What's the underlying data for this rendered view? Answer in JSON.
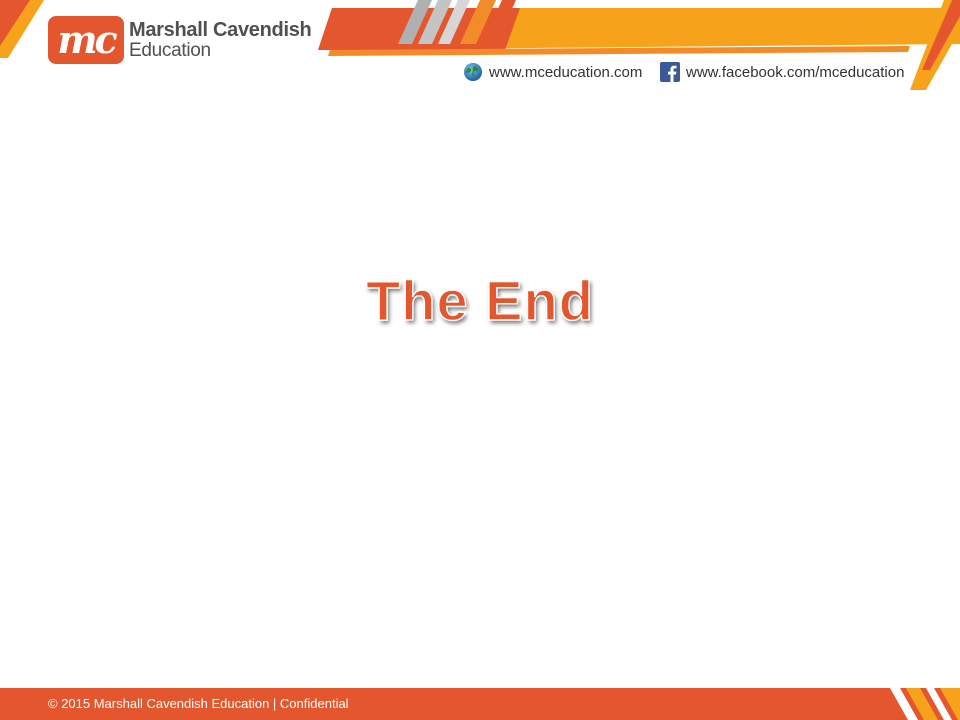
{
  "brand": {
    "logo_mark": "mc",
    "name": "Marshall Cavendish",
    "subtitle": "Education",
    "primary_color": "#e4572e",
    "accent_color": "#f7a21b"
  },
  "header_links": [
    {
      "icon": "globe-icon",
      "text": "www.mceducation.com"
    },
    {
      "icon": "facebook-icon",
      "text": "www.facebook.com/mceducation"
    }
  ],
  "slide": {
    "title": "The End"
  },
  "footer": {
    "text": "© 2015 Marshall Cavendish Education | Confidential"
  }
}
